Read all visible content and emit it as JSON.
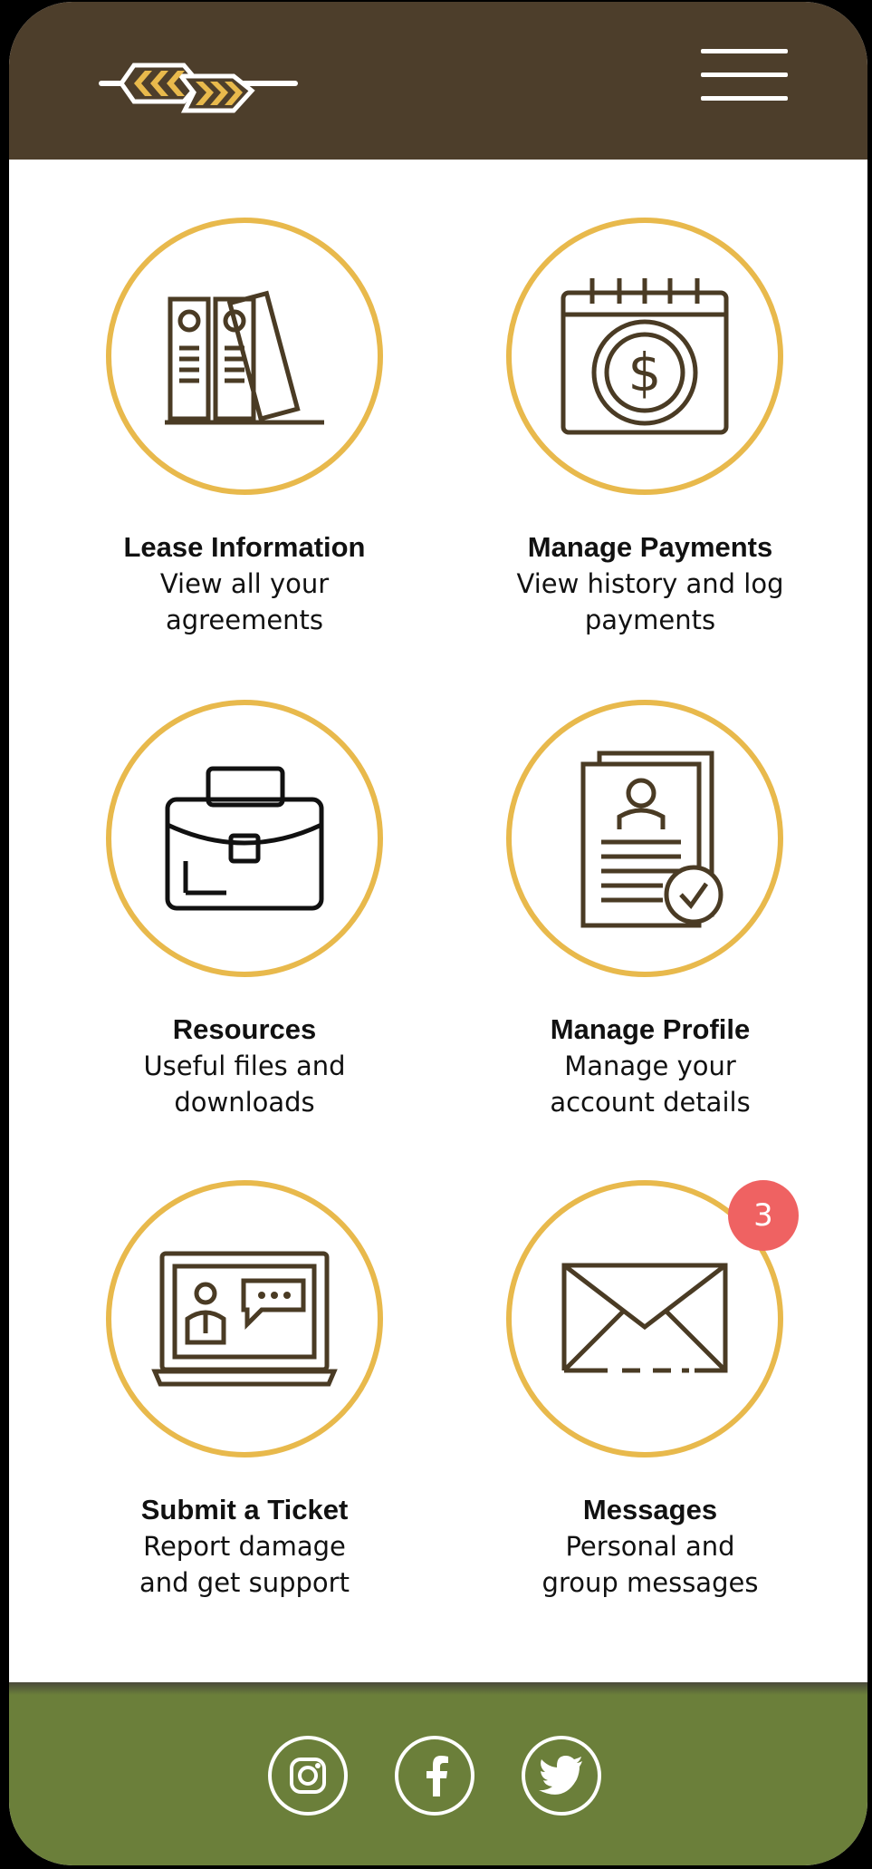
{
  "colors": {
    "header_bg": "#4d3e2b",
    "accent_gold": "#e8b94c",
    "footer_green": "#6b7f3a",
    "badge_red": "#ef6262",
    "icon_brown": "#4a3b24"
  },
  "header": {
    "logo_icon": "wheat-chevron-logo",
    "menu_icon": "hamburger-menu-icon"
  },
  "tiles": [
    {
      "title": "Lease Information",
      "subtitle_line1": "View all your",
      "subtitle_line2": "agreements",
      "icon": "binders-icon"
    },
    {
      "title": "Manage Payments",
      "subtitle_line1": "View history and log",
      "subtitle_line2": "payments",
      "icon": "calendar-dollar-icon"
    },
    {
      "title": "Resources",
      "subtitle_line1": "Useful files and",
      "subtitle_line2": "downloads",
      "icon": "briefcase-icon"
    },
    {
      "title": "Manage Profile",
      "subtitle_line1": "Manage your",
      "subtitle_line2": "account details",
      "icon": "profile-document-icon"
    },
    {
      "title": "Submit a Ticket",
      "subtitle_line1": "Report damage",
      "subtitle_line2": "and get support",
      "icon": "laptop-chat-icon"
    },
    {
      "title": "Messages",
      "subtitle_line1": "Personal and",
      "subtitle_line2": "group messages",
      "icon": "envelope-icon",
      "badge": "3"
    }
  ],
  "footer": {
    "social": [
      "instagram-icon",
      "facebook-icon",
      "twitter-icon"
    ]
  }
}
